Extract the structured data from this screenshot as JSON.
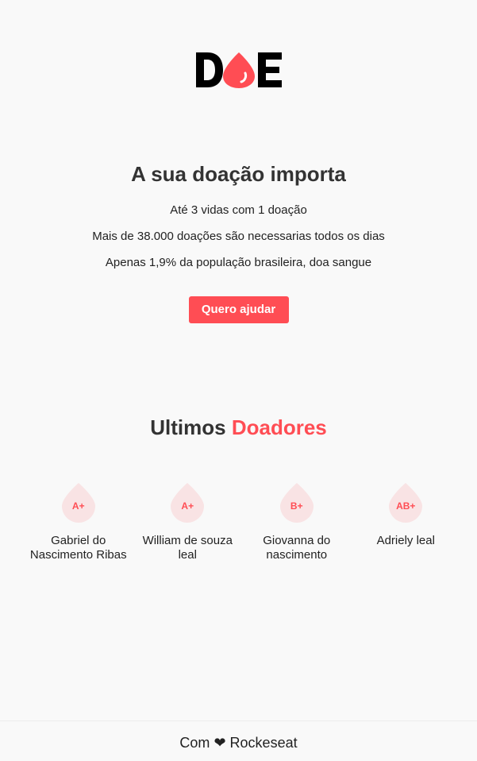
{
  "brand": {
    "logo_text": "DOE",
    "accent_color": "#ff4d54"
  },
  "hero": {
    "title": "A sua doação importa",
    "lines": [
      "Até 3 vidas com 1 doação",
      "Mais de 38.000 doações são necessarias todos os dias",
      "Apenas 1,9% da população brasileira, doa sangue"
    ],
    "cta_label": "Quero ajudar"
  },
  "donors_section": {
    "title_plain": "Ultimos",
    "title_accent": "Doadores",
    "donors": [
      {
        "blood_type": "A+",
        "name": "Gabriel do Nascimento Ribas"
      },
      {
        "blood_type": "A+",
        "name": "William de souza leal"
      },
      {
        "blood_type": "B+",
        "name": "Giovanna do nascimento"
      },
      {
        "blood_type": "AB+",
        "name": "Adriely leal"
      }
    ]
  },
  "footer": {
    "prefix": "Com",
    "icon": "heart-icon",
    "suffix": "Rockeseat"
  }
}
